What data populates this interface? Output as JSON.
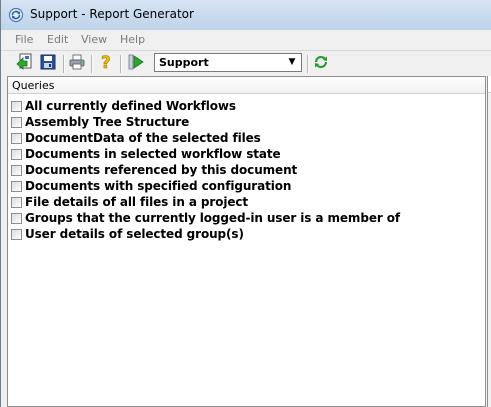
{
  "window": {
    "title": "Support - Report Generator",
    "app_icon": "refresh-document-icon"
  },
  "menu": {
    "items": [
      {
        "label": "File"
      },
      {
        "label": "Edit"
      },
      {
        "label": "View"
      },
      {
        "label": "Help"
      }
    ]
  },
  "toolbar": {
    "buttons": [
      {
        "name": "import-icon"
      },
      {
        "name": "save-icon"
      },
      {
        "name": "print-icon"
      },
      {
        "name": "help-icon"
      },
      {
        "name": "run-icon"
      },
      {
        "name": "refresh-icon"
      }
    ],
    "selected_source": "Support",
    "colors": {
      "refresh_green": "#2a9a2a",
      "help_yellow": "#f0c000",
      "run_green": "#2fa82f",
      "save_blue": "#2a4f9a"
    }
  },
  "panel": {
    "header": "Queries",
    "queries": [
      {
        "label": "All currently defined Workflows",
        "checked": false
      },
      {
        "label": "Assembly Tree Structure",
        "checked": false
      },
      {
        "label": "DocumentData of the selected files",
        "checked": false
      },
      {
        "label": "Documents in selected workflow state",
        "checked": false
      },
      {
        "label": "Documents referenced by this document",
        "checked": false
      },
      {
        "label": "Documents with specified configuration",
        "checked": false
      },
      {
        "label": "File details of all files in a project",
        "checked": false
      },
      {
        "label": "Groups that the currently logged-in user is a member of",
        "checked": false
      },
      {
        "label": "User details of selected group(s)",
        "checked": false
      }
    ]
  }
}
